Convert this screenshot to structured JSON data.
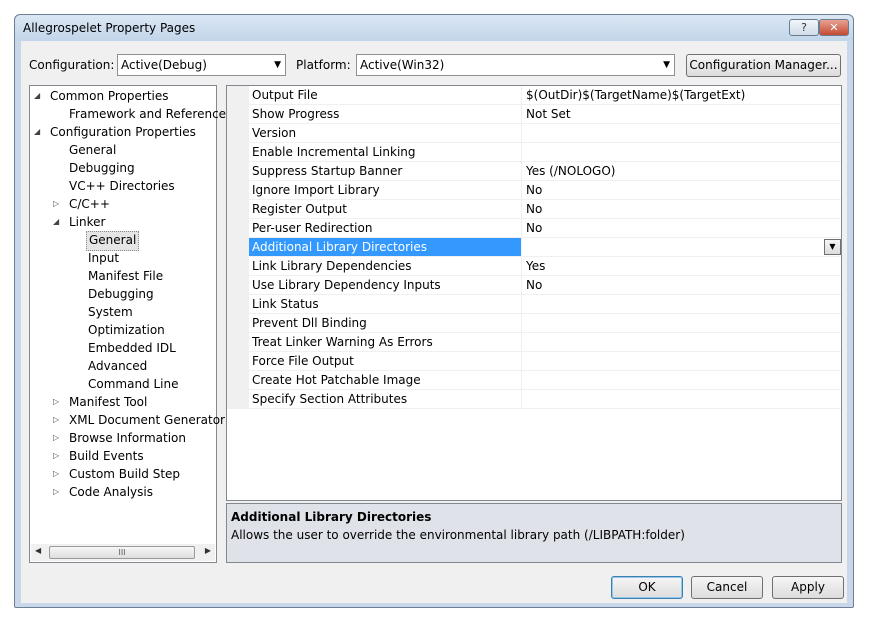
{
  "window": {
    "title": "Allegrospelet Property Pages",
    "help_label": "?",
    "close_label": "✕"
  },
  "config": {
    "configuration_label": "Configuration:",
    "configuration_value": "Active(Debug)",
    "platform_label": "Platform:",
    "platform_value": "Active(Win32)",
    "manager_button": "Configuration Manager..."
  },
  "tree": {
    "items": [
      {
        "label": "Common Properties",
        "expander": "◢"
      },
      {
        "label": "Framework and References",
        "expander": ""
      },
      {
        "label": "Configuration Properties",
        "expander": "◢"
      },
      {
        "label": "General",
        "expander": ""
      },
      {
        "label": "Debugging",
        "expander": ""
      },
      {
        "label": "VC++ Directories",
        "expander": ""
      },
      {
        "label": "C/C++",
        "expander": "▷"
      },
      {
        "label": "Linker",
        "expander": "◢"
      },
      {
        "label": "General",
        "expander": ""
      },
      {
        "label": "Input",
        "expander": ""
      },
      {
        "label": "Manifest File",
        "expander": ""
      },
      {
        "label": "Debugging",
        "expander": ""
      },
      {
        "label": "System",
        "expander": ""
      },
      {
        "label": "Optimization",
        "expander": ""
      },
      {
        "label": "Embedded IDL",
        "expander": ""
      },
      {
        "label": "Advanced",
        "expander": ""
      },
      {
        "label": "Command Line",
        "expander": ""
      },
      {
        "label": "Manifest Tool",
        "expander": "▷"
      },
      {
        "label": "XML Document Generator",
        "expander": "▷"
      },
      {
        "label": "Browse Information",
        "expander": "▷"
      },
      {
        "label": "Build Events",
        "expander": "▷"
      },
      {
        "label": "Custom Build Step",
        "expander": "▷"
      },
      {
        "label": "Code Analysis",
        "expander": "▷"
      }
    ],
    "scroll_left": "◀",
    "scroll_right": "▶",
    "scroll_thumb": "III"
  },
  "properties": [
    {
      "name": "Output File",
      "value": "$(OutDir)$(TargetName)$(TargetExt)"
    },
    {
      "name": "Show Progress",
      "value": "Not Set"
    },
    {
      "name": "Version",
      "value": ""
    },
    {
      "name": "Enable Incremental Linking",
      "value": ""
    },
    {
      "name": "Suppress Startup Banner",
      "value": "Yes (/NOLOGO)"
    },
    {
      "name": "Ignore Import Library",
      "value": "No"
    },
    {
      "name": "Register Output",
      "value": "No"
    },
    {
      "name": "Per-user Redirection",
      "value": "No"
    },
    {
      "name": "Additional Library Directories",
      "value": ""
    },
    {
      "name": "Link Library Dependencies",
      "value": "Yes"
    },
    {
      "name": "Use Library Dependency Inputs",
      "value": "No"
    },
    {
      "name": "Link Status",
      "value": ""
    },
    {
      "name": "Prevent Dll Binding",
      "value": ""
    },
    {
      "name": "Treat Linker Warning As Errors",
      "value": ""
    },
    {
      "name": "Force File Output",
      "value": ""
    },
    {
      "name": "Create Hot Patchable Image",
      "value": ""
    },
    {
      "name": "Specify Section Attributes",
      "value": ""
    }
  ],
  "description": {
    "title": "Additional Library Directories",
    "text": "Allows the user to override the environmental library path (/LIBPATH:folder)"
  },
  "buttons": {
    "ok": "OK",
    "cancel": "Cancel",
    "apply": "Apply"
  },
  "icons": {
    "dropdown": "▼"
  }
}
